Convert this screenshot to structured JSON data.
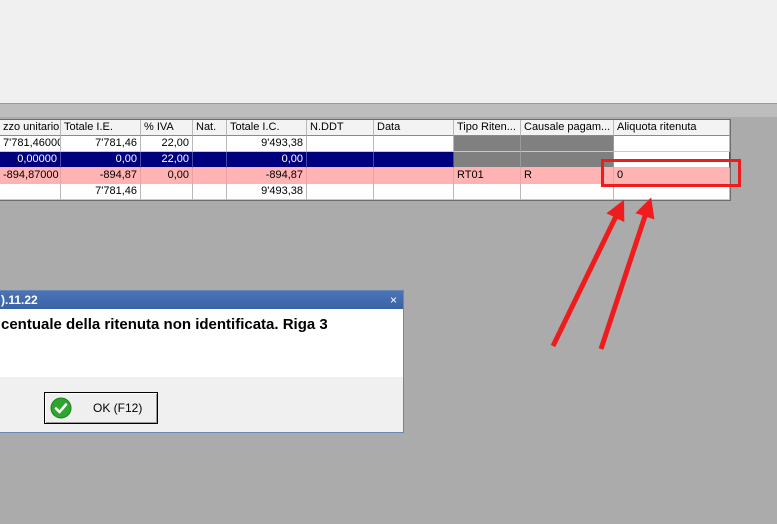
{
  "grid": {
    "headers": [
      "zzo unitario",
      "Totale I.E.",
      "% IVA",
      "Nat.",
      "Totale I.C.",
      "N.DDT",
      "Data",
      "Tipo Riten...",
      "Causale pagam...",
      "Aliquota ritenuta"
    ],
    "rows": [
      [
        "7'781,46000",
        "7'781,46",
        "22,00",
        "",
        "9'493,38",
        "",
        "",
        "",
        "",
        ""
      ],
      [
        "0,00000",
        "0,00",
        "22,00",
        "",
        "0,00",
        "",
        "",
        "",
        "",
        ""
      ],
      [
        "-894,87000",
        "-894,87",
        "0,00",
        "",
        "-894,87",
        "",
        "",
        "RT01",
        "R",
        "0"
      ],
      [
        "",
        "7'781,46",
        "",
        "",
        "9'493,38",
        "",
        "",
        "",
        "",
        ""
      ]
    ]
  },
  "dialog": {
    "title": ").11.22",
    "close_symbol": "×",
    "message": "centuale della ritenuta non identificata. Riga 3",
    "ok_label": "OK (F12)"
  },
  "colors": {
    "selected_row": "#00007e",
    "error_row": "#ffb3b3",
    "annotation": "#ee1c1c",
    "background": "#ababab"
  },
  "icons": {
    "ok": "checkmark-circle-icon"
  }
}
